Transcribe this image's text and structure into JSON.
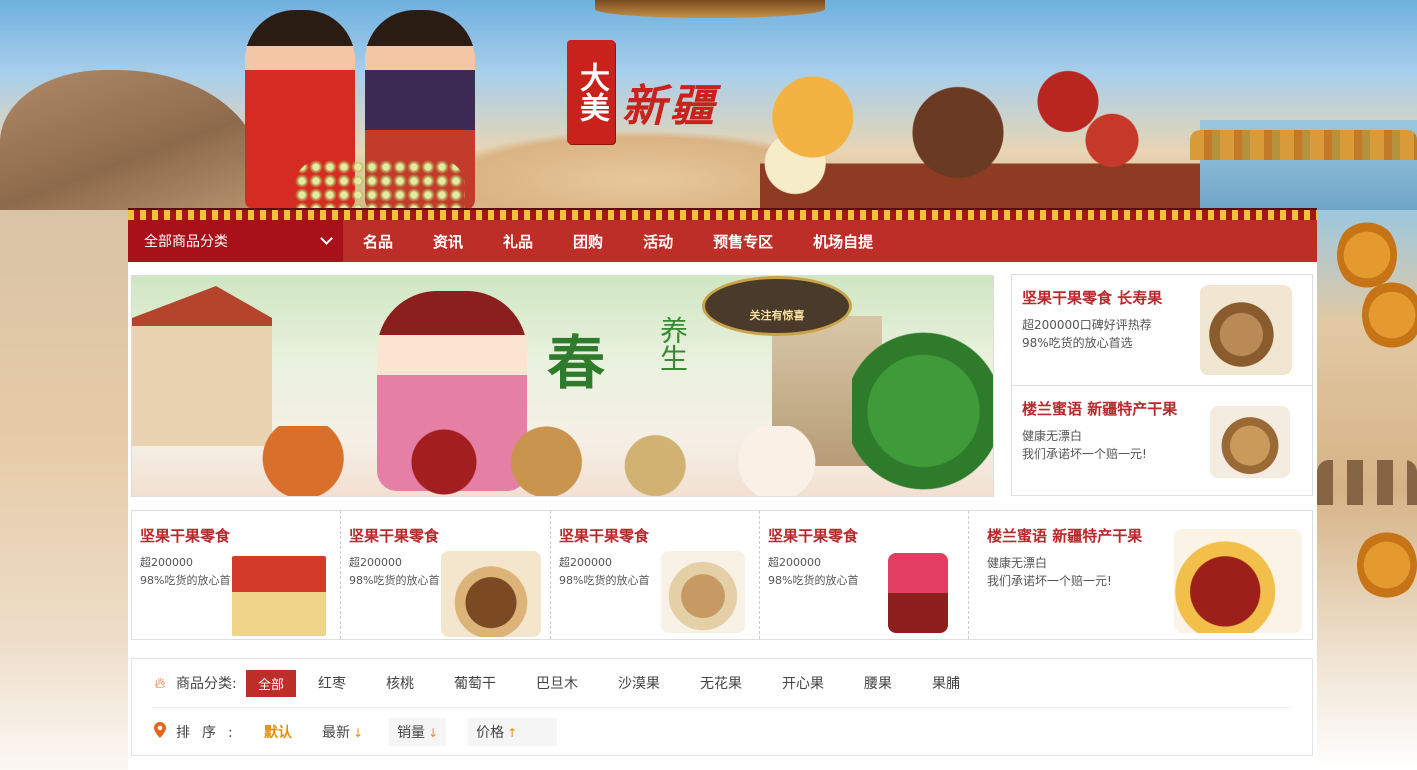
{
  "banner": {
    "seal_text": "大美",
    "logo_text": "新疆"
  },
  "nav": {
    "category_dropdown": "全部商品分类",
    "items": [
      "名品",
      "资讯",
      "礼品",
      "团购",
      "活动",
      "预售专区",
      "机场自提"
    ]
  },
  "carousel": {
    "title": "春",
    "subtitle": "养生",
    "sign_text": "关注有惊喜"
  },
  "side_promos": [
    {
      "title": "坚果干果零食 长寿果",
      "desc1": "超200000口碑好评热荐",
      "desc2": "98%吃货的放心首选"
    },
    {
      "title": "楼兰蜜语 新疆特产干果",
      "desc1": "健康无漂白",
      "desc2": "我们承诺坏一个赔一元!"
    }
  ],
  "products": [
    {
      "title": "坚果干果零食",
      "desc1": "超200000",
      "desc2": "98%吃货的放心首"
    },
    {
      "title": "坚果干果零食",
      "desc1": "超200000",
      "desc2": "98%吃货的放心首"
    },
    {
      "title": "坚果干果零食",
      "desc1": "超200000",
      "desc2": "98%吃货的放心首"
    },
    {
      "title": "坚果干果零食",
      "desc1": "超200000",
      "desc2": "98%吃货的放心首"
    },
    {
      "title": "楼兰蜜语 新疆特产干果",
      "desc1": "健康无漂白",
      "desc2": "我们承诺坏一个赔一元!"
    }
  ],
  "filter": {
    "category_label": "商品分类:",
    "categories": [
      "全部",
      "红枣",
      "核桃",
      "葡萄干",
      "巴旦木",
      "沙漠果",
      "无花果",
      "开心果",
      "腰果",
      "果脯"
    ],
    "sort_label": "排序:",
    "sorts": [
      "默认",
      "最新",
      "销量",
      "价格"
    ],
    "sort_arrows": [
      "",
      "↓",
      "↓",
      "↑"
    ]
  },
  "colors": {
    "brand_red": "#be2e28",
    "dropdown_red": "#a8101a",
    "title_red": "#b9282b",
    "accent_orange": "#e8641b"
  },
  "icons": {
    "category": "flame-icon",
    "sort": "location-pin-icon",
    "dropdown": "chevron-down-icon"
  }
}
